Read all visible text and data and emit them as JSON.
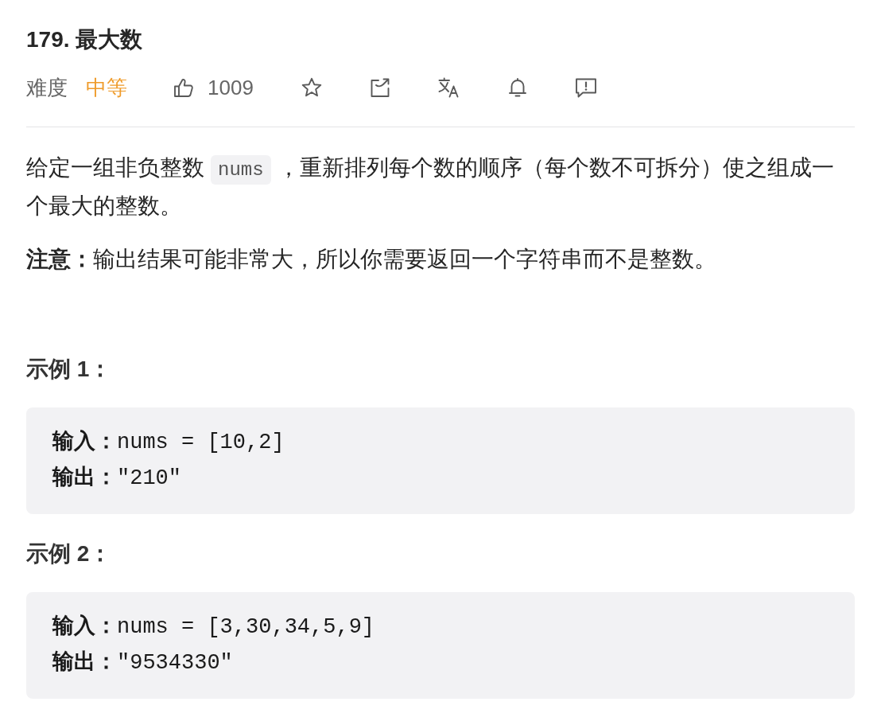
{
  "title": "179. 最大数",
  "meta": {
    "difficulty_label": "难度",
    "difficulty": {
      "value": "中等",
      "kind": "medium"
    },
    "likes": "1009"
  },
  "description": {
    "parts": [
      {
        "kind": "text",
        "text": "给定一组非负整数"
      },
      {
        "kind": "code",
        "text": "nums"
      },
      {
        "kind": "text",
        "text": "，重新排列每个数的顺序（每个数不可拆分）使之组成一个最大的整数。"
      }
    ]
  },
  "note": "**注意：**输出结果可能非常大，所以你需要返回一个字符串而不是整数。",
  "examples": [
    {
      "heading": "示例 1：",
      "lines": [
        "**输入：**nums = [10,2]",
        "**输出：**\"210\""
      ]
    },
    {
      "heading": "示例 2：",
      "lines": [
        "**输入：**nums = [3,30,34,5,9]",
        "**输出：**\"9534330\""
      ]
    }
  ]
}
